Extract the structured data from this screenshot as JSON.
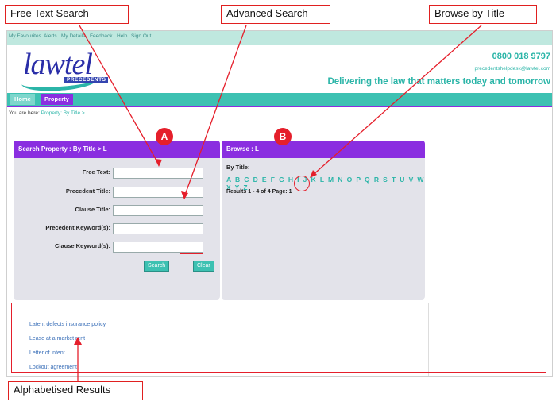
{
  "callouts": {
    "free_text": "Free Text Search",
    "advanced": "Advanced Search",
    "browse": "Browse by Title",
    "results": "Alphabetised Results"
  },
  "badges": {
    "a": "A",
    "b": "B"
  },
  "topnav": [
    "My Favourites",
    "Alerts",
    "My Details",
    "Feedback",
    "Help",
    "Sign Out"
  ],
  "logo": {
    "word": "lawtel",
    "sub": "PRECEDENTS"
  },
  "contact": {
    "phone": "0800 018 9797",
    "email": "precedentshelpdesk@lawtel.com"
  },
  "tagline": "Delivering the law that matters today and tomorrow",
  "mainnav": {
    "home": "Home",
    "property": "Property"
  },
  "breadcrumb": {
    "prefix": "You are here:",
    "path": "Property: By Title  >  L"
  },
  "search_panel": {
    "title": "Search Property : By Title > L",
    "fields": [
      "Free Text:",
      "Precedent Title:",
      "Clause Title:",
      "Precedent Keyword(s):",
      "Clause Keyword(s):"
    ],
    "search_btn": "Search",
    "clear_btn": "Clear"
  },
  "browse_panel": {
    "title": "Browse : L",
    "by_title": "By Title:",
    "letters": "A B C D E F G H I J K L M N O P Q R S T U V W X Y Z",
    "results": "Results 1 - 4 of 4   Page: 1"
  },
  "list": [
    "Latent defects insurance policy",
    "Lease at a market rent",
    "Letter of intent",
    "Lockout agreement"
  ],
  "colors": {
    "accent": "#8a2ee0",
    "teal": "#3dc1b2",
    "callout_red": "#e51f2b"
  }
}
